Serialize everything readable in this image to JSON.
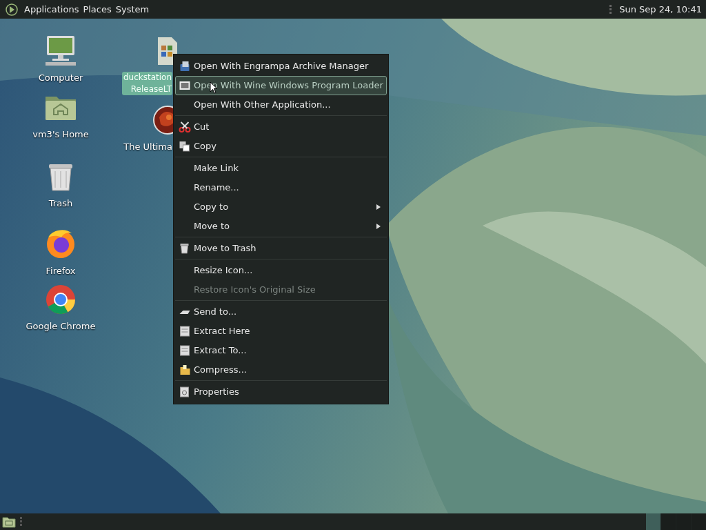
{
  "top_panel": {
    "menus": [
      {
        "label": "Applications"
      },
      {
        "label": "Places"
      },
      {
        "label": "System"
      }
    ],
    "clock": "Sun Sep 24, 10:41"
  },
  "desktop_icons": [
    {
      "lines": [
        "Computer"
      ],
      "selected": false
    },
    {
      "lines": [
        "vm3's Home"
      ],
      "selected": false
    },
    {
      "lines": [
        "Trash"
      ],
      "selected": false
    },
    {
      "lines": [
        "Firefox"
      ],
      "selected": false
    },
    {
      "lines": [
        "Google Chrome"
      ],
      "selected": false
    },
    {
      "lines": [
        "duckstation",
        "ReleaseLT"
      ],
      "selected": true
    },
    {
      "lines": [
        "The Ultima"
      ],
      "selected": false
    }
  ],
  "context_menu": {
    "groups": [
      [
        {
          "label": "Open With Engrampa Archive Manager",
          "selected": false,
          "disabled": false,
          "submenu": false
        },
        {
          "label": "Open With Wine Windows Program Loader",
          "selected": true,
          "disabled": false,
          "submenu": false
        },
        {
          "label": "Open With Other Application...",
          "selected": false,
          "disabled": false,
          "submenu": false
        }
      ],
      [
        {
          "label": "Cut",
          "selected": false,
          "disabled": false,
          "submenu": false
        },
        {
          "label": "Copy",
          "selected": false,
          "disabled": false,
          "submenu": false
        }
      ],
      [
        {
          "label": "Make Link",
          "selected": false,
          "disabled": false,
          "submenu": false
        },
        {
          "label": "Rename...",
          "selected": false,
          "disabled": false,
          "submenu": false
        },
        {
          "label": "Copy to",
          "selected": false,
          "disabled": false,
          "submenu": true
        },
        {
          "label": "Move to",
          "selected": false,
          "disabled": false,
          "submenu": true
        }
      ],
      [
        {
          "label": "Move to Trash",
          "selected": false,
          "disabled": false,
          "submenu": false
        }
      ],
      [
        {
          "label": "Resize Icon...",
          "selected": false,
          "disabled": false,
          "submenu": false
        },
        {
          "label": "Restore Icon's Original Size",
          "selected": false,
          "disabled": true,
          "submenu": false
        }
      ],
      [
        {
          "label": "Send to...",
          "selected": false,
          "disabled": false,
          "submenu": false
        },
        {
          "label": "Extract Here",
          "selected": false,
          "disabled": false,
          "submenu": false
        },
        {
          "label": "Extract To...",
          "selected": false,
          "disabled": false,
          "submenu": false
        },
        {
          "label": "Compress...",
          "selected": false,
          "disabled": false,
          "submenu": false
        }
      ],
      [
        {
          "label": "Properties",
          "selected": false,
          "disabled": false,
          "submenu": false
        }
      ]
    ]
  }
}
